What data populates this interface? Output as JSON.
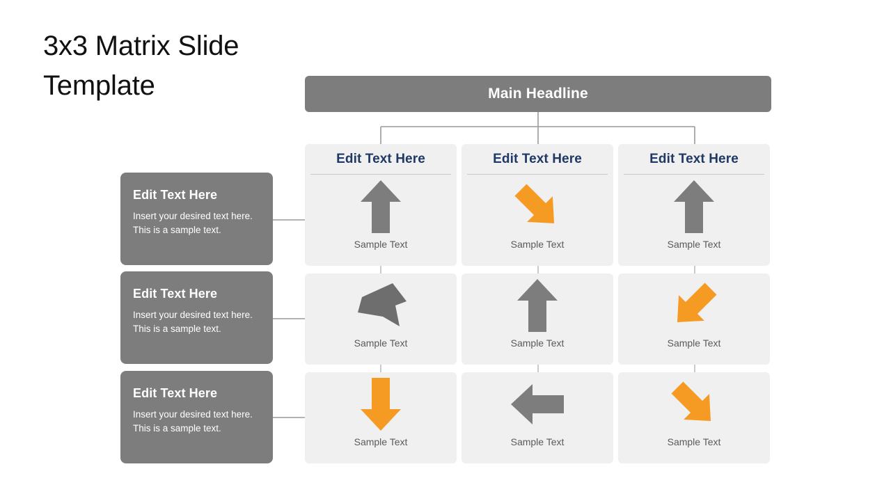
{
  "slide": {
    "title": "3x3 Matrix Slide Template",
    "headline": "Main Headline",
    "colors": {
      "gray": "#7d7d7d",
      "orange": "#F59B23",
      "panel": "#f0f0f0",
      "navy": "#1f3864",
      "connector": "#9a9a9a"
    }
  },
  "columns": [
    {
      "header": "Edit Text Here"
    },
    {
      "header": "Edit Text Here"
    },
    {
      "header": "Edit Text Here"
    }
  ],
  "info_boxes": [
    {
      "title": "Edit Text Here",
      "body": "Insert your desired text here. This is a sample text."
    },
    {
      "title": "Edit Text Here",
      "body": "Insert your desired text here. This is a sample text."
    },
    {
      "title": "Edit Text Here",
      "body": "Insert your desired text here. This is a sample text."
    }
  ],
  "cells": [
    [
      {
        "label": "Sample Text",
        "icon": "arrow-up-icon",
        "color": "#7d7d7d"
      },
      {
        "label": "Sample Text",
        "icon": "arrow-down-right-diagonal-icon",
        "color": "#F59B23"
      },
      {
        "label": "Sample Text",
        "icon": "arrow-up-icon",
        "color": "#7d7d7d"
      }
    ],
    [
      {
        "label": "Sample Text",
        "icon": "arrow-swept-up-right-icon",
        "color": "#7d7d7d"
      },
      {
        "label": "Sample Text",
        "icon": "arrow-up-icon",
        "color": "#7d7d7d"
      },
      {
        "label": "Sample Text",
        "icon": "arrow-down-left-diagonal-icon",
        "color": "#F59B23"
      }
    ],
    [
      {
        "label": "Sample Text",
        "icon": "arrow-down-icon",
        "color": "#F59B23"
      },
      {
        "label": "Sample Text",
        "icon": "arrow-left-icon",
        "color": "#7d7d7d"
      },
      {
        "label": "Sample Text",
        "icon": "arrow-down-right-diagonal-icon",
        "color": "#F59B23"
      }
    ]
  ]
}
